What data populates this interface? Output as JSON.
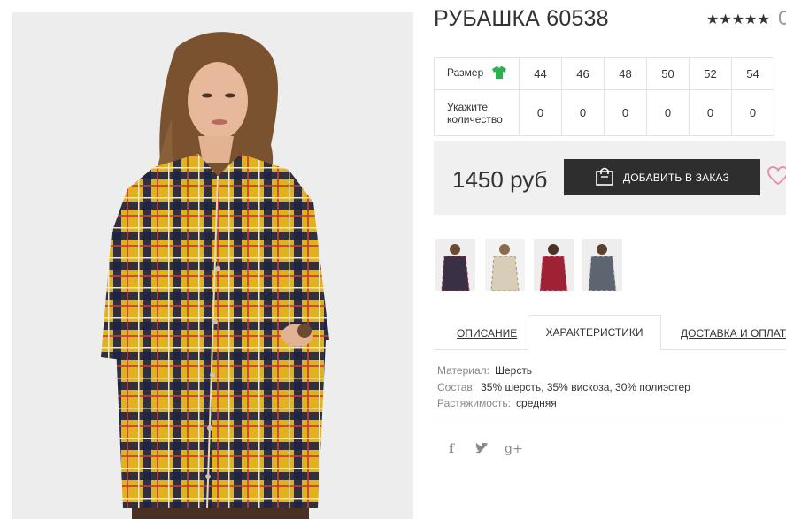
{
  "product": {
    "title": "РУБАШКА 60538",
    "rating_stars": "★★★★★",
    "rating_value": 5
  },
  "sizes": {
    "size_label": "Размер",
    "qty_label_line1": "Укажите",
    "qty_label_line2": "количество",
    "values": [
      "44",
      "46",
      "48",
      "50",
      "52",
      "54"
    ],
    "quantities": [
      "0",
      "0",
      "0",
      "0",
      "0",
      "0"
    ]
  },
  "price": {
    "amount": "1450 руб",
    "order_button": "ДОБАВИТЬ В ЗАКАЗ"
  },
  "thumbnails": [
    {
      "color": "#3a3046",
      "name": "thumb-navy-red"
    },
    {
      "color": "#d8cdb8",
      "name": "thumb-beige"
    },
    {
      "color": "#9e2233",
      "name": "thumb-red"
    },
    {
      "color": "#5d6670",
      "name": "thumb-grey"
    }
  ],
  "tabs": {
    "description": "ОПИСАНИЕ",
    "characteristics": "ХАРАКТЕРИСТИКИ",
    "delivery": "ДОСТАВКА И ОПЛАТА"
  },
  "specs": {
    "material_key": "Материал:",
    "material_val": "Шерсть",
    "composition_key": "Состав:",
    "composition_val": "35% шерсть, 35% вискоза, 30% полиэстер",
    "stretch_key": "Растяжимость:",
    "stretch_val": "средняя"
  },
  "social": {
    "facebook": "f",
    "twitter": "twitter-icon",
    "googleplus": "g+"
  },
  "colors": {
    "shirt_yellow": "#e0b21c",
    "shirt_navy": "#1f2240",
    "button_dark": "#2e2e2e",
    "size_icon_green": "#2bb24c",
    "heart_pink": "#e88aa0"
  }
}
